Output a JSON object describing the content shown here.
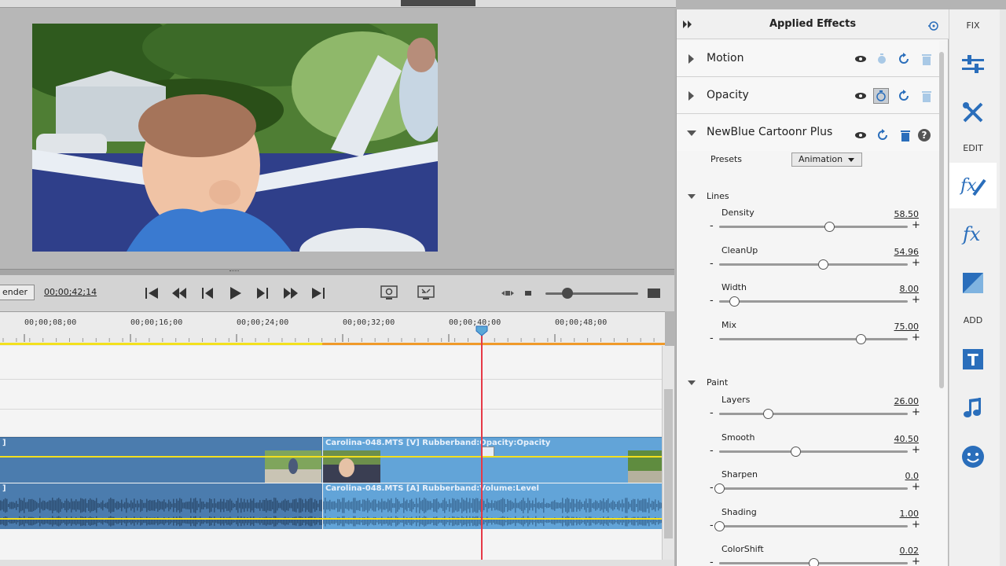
{
  "transport": {
    "render_label": "ender",
    "timecode": "00;00;42;14"
  },
  "timeline": {
    "ruler_labels": [
      "00;00;08;00",
      "00;00;16;00",
      "00;00;24;00",
      "00;00;32;00",
      "00;00;40;00",
      "00;00;48;00"
    ],
    "clips": {
      "video_left_label": "]",
      "video_right_label": "Carolina-048.MTS [V] Rubberband:Opacity:Opacity",
      "audio_left_label": "]",
      "audio_right_label": "Carolina-048.MTS [A] Rubberband:Volume:Level"
    }
  },
  "effects_panel": {
    "title": "Applied Effects",
    "effects": [
      {
        "name": "Motion"
      },
      {
        "name": "Opacity"
      },
      {
        "name": "NewBlue Cartoonr Plus"
      }
    ],
    "presets": {
      "label": "Presets",
      "value": "Animation"
    },
    "sections": {
      "lines": {
        "label": "Lines",
        "params": [
          {
            "label": "Density",
            "value": "58.50",
            "fraction": 0.585
          },
          {
            "label": "CleanUp",
            "value": "54.96",
            "fraction": 0.55
          },
          {
            "label": "Width",
            "value": "8.00",
            "fraction": 0.08
          },
          {
            "label": "Mix",
            "value": "75.00",
            "fraction": 0.75
          }
        ]
      },
      "paint": {
        "label": "Paint",
        "params": [
          {
            "label": "Layers",
            "value": "26.00",
            "fraction": 0.26
          },
          {
            "label": "Smooth",
            "value": "40.50",
            "fraction": 0.405
          },
          {
            "label": "Sharpen",
            "value": "0.0",
            "fraction": 0.0
          },
          {
            "label": "Shading",
            "value": "1.00",
            "fraction": 0.0
          },
          {
            "label": "ColorShift",
            "value": "0.02",
            "fraction": 0.5
          }
        ]
      }
    }
  },
  "sidebar": {
    "fix_label": "FIX",
    "edit_label": "EDIT",
    "add_label": "ADD"
  },
  "colors": {
    "accent_blue": "#2a6ebb",
    "clip_dark": "#4b7cae",
    "clip_light": "#62a4d8",
    "playhead": "#e63946"
  }
}
